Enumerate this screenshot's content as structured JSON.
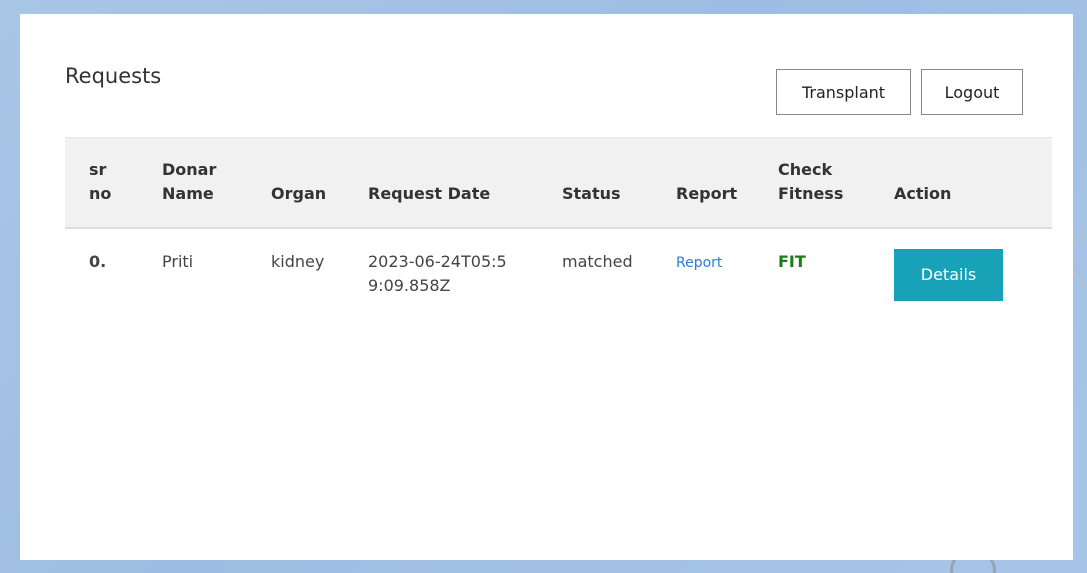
{
  "page": {
    "title": "Requests"
  },
  "header_buttons": {
    "transplant": "Transplant",
    "logout": "Logout"
  },
  "table": {
    "columns": [
      "sr no",
      "Donar Name",
      "Organ",
      "Request Date",
      "Status",
      "Report",
      "Check Fitness",
      "Action"
    ],
    "rows": [
      {
        "sr_no": "0.",
        "donar_name": "Priti",
        "organ": "kidney",
        "request_date": "2023-06-24T05:59:09.858Z",
        "status": "matched",
        "report": "Report",
        "check_fitness": "FIT",
        "action": "Details"
      }
    ]
  },
  "colors": {
    "details_button": "#17a2b8",
    "fit_text": "#1a7d1a",
    "report_link": "#2a7ae2",
    "header_row_bg": "#f1f1f1"
  }
}
